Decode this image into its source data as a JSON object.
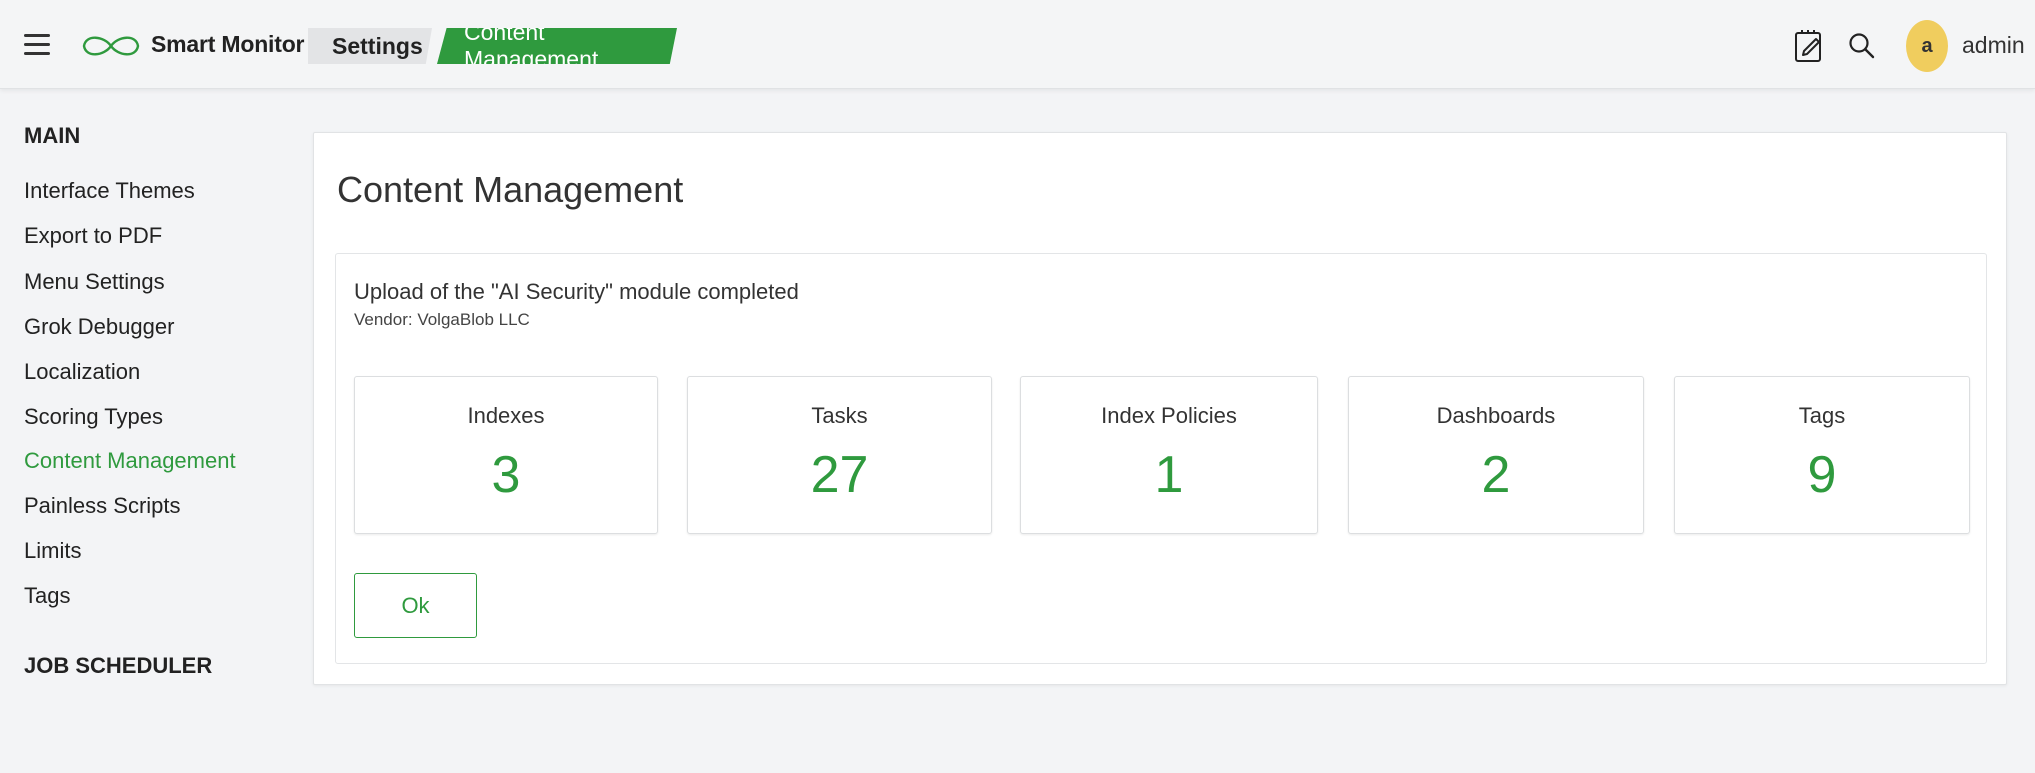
{
  "header": {
    "brand": "Smart Monitor",
    "breadcrumb": {
      "parent": "Settings",
      "current": "Content Management"
    },
    "user": {
      "avatar_letter": "a",
      "name": "admin"
    },
    "icons": [
      "menu-icon",
      "infinity-logo-icon",
      "notes-icon",
      "search-icon"
    ]
  },
  "sidebar": {
    "sections": [
      {
        "title": "MAIN",
        "items": [
          {
            "label": "Interface Themes",
            "active": false
          },
          {
            "label": "Export to PDF",
            "active": false
          },
          {
            "label": "Menu Settings",
            "active": false
          },
          {
            "label": "Grok Debugger",
            "active": false
          },
          {
            "label": "Localization",
            "active": false
          },
          {
            "label": "Scoring Types",
            "active": false
          },
          {
            "label": "Content Management",
            "active": true
          },
          {
            "label": "Painless Scripts",
            "active": false
          },
          {
            "label": "Limits",
            "active": false
          },
          {
            "label": "Tags",
            "active": false
          }
        ]
      },
      {
        "title": "JOB SCHEDULER",
        "items": []
      }
    ]
  },
  "main": {
    "title": "Content Management",
    "message": {
      "title": "Upload of the \"AI Security\" module completed",
      "vendor": "Vendor: VolgaBlob LLC"
    },
    "stats": [
      {
        "label": "Indexes",
        "value": "3"
      },
      {
        "label": "Tasks",
        "value": "27"
      },
      {
        "label": "Index Policies",
        "value": "1"
      },
      {
        "label": "Dashboards",
        "value": "2"
      },
      {
        "label": "Tags",
        "value": "9"
      }
    ],
    "ok_label": "Ok"
  },
  "colors": {
    "accent": "#2f9a3e",
    "avatar": "#f0cd5e",
    "background": "#f3f4f6"
  }
}
